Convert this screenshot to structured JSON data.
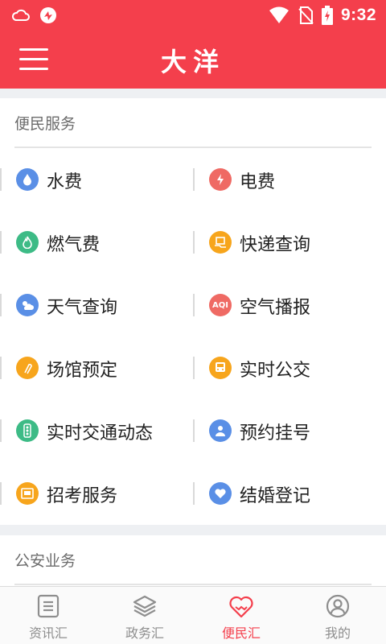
{
  "status_bar": {
    "time": "9:32"
  },
  "header": {
    "title": "大洋"
  },
  "sections": [
    {
      "title": "便民服务",
      "items": [
        {
          "label": "水费",
          "icon": "water-drop-icon",
          "color": "#5a8fe6"
        },
        {
          "label": "电费",
          "icon": "electricity-icon",
          "color": "#ef6a64"
        },
        {
          "label": "燃气费",
          "icon": "gas-flame-icon",
          "color": "#3dbb86"
        },
        {
          "label": "快递查询",
          "icon": "package-delivery-icon",
          "color": "#f7a51c"
        },
        {
          "label": "天气查询",
          "icon": "weather-icon",
          "color": "#5a8fe6"
        },
        {
          "label": "空气播报",
          "icon": "aqi-icon",
          "color": "#ef6a64",
          "glyph": "AQI"
        },
        {
          "label": "场馆预定",
          "icon": "venue-icon",
          "color": "#f7a51c"
        },
        {
          "label": "实时公交",
          "icon": "bus-icon",
          "color": "#f7a51c"
        },
        {
          "label": "实时交通动态",
          "icon": "traffic-light-icon",
          "color": "#3dbb86"
        },
        {
          "label": "预约挂号",
          "icon": "medical-appointment-icon",
          "color": "#5a8fe6"
        },
        {
          "label": "招考服务",
          "icon": "exam-service-icon",
          "color": "#f7a51c"
        },
        {
          "label": "结婚登记",
          "icon": "heart-icon",
          "color": "#5a8fe6"
        }
      ]
    },
    {
      "title": "公安业务"
    }
  ],
  "tabs": [
    {
      "label": "资讯汇",
      "icon": "news-icon",
      "active": false
    },
    {
      "label": "政务汇",
      "icon": "layers-icon",
      "active": false
    },
    {
      "label": "便民汇",
      "icon": "handshake-heart-icon",
      "active": true
    },
    {
      "label": "我的",
      "icon": "user-profile-icon",
      "active": false
    }
  ],
  "colors": {
    "brand": "#f43f4c",
    "active_tab": "#f43f4c",
    "inactive_tab": "#8e8e8e"
  }
}
